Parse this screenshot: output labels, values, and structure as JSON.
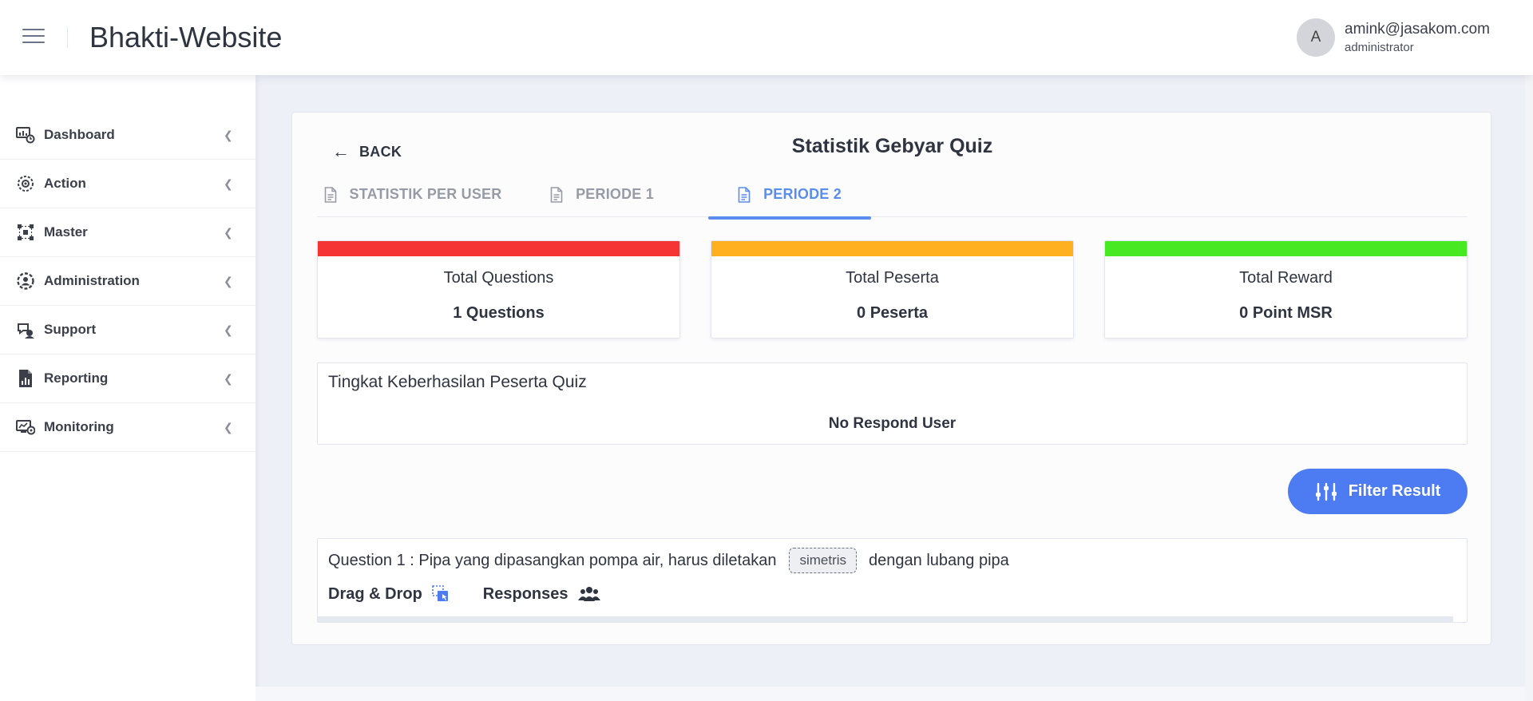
{
  "header": {
    "app_title": "Bhakti-Website",
    "user": {
      "avatar_letter": "A",
      "email": "amink@jasakom.com",
      "role": "administrator"
    }
  },
  "sidebar": {
    "items": [
      {
        "label": "Dashboard",
        "icon": "dashboard-icon"
      },
      {
        "label": "Action",
        "icon": "action-icon"
      },
      {
        "label": "Master",
        "icon": "master-icon"
      },
      {
        "label": "Administration",
        "icon": "administration-icon"
      },
      {
        "label": "Support",
        "icon": "support-icon"
      },
      {
        "label": "Reporting",
        "icon": "reporting-icon"
      },
      {
        "label": "Monitoring",
        "icon": "monitoring-icon"
      }
    ]
  },
  "page": {
    "back_label": "BACK",
    "title": "Statistik Gebyar Quiz",
    "tabs": [
      {
        "label": "STATISTIK PER USER",
        "active": false
      },
      {
        "label": "PERIODE 1",
        "active": false
      },
      {
        "label": "PERIODE 2",
        "active": true
      }
    ]
  },
  "stats": [
    {
      "title": "Total Questions",
      "value": "1 Questions",
      "color": "#f53434"
    },
    {
      "title": "Total Peserta",
      "value": "0 Peserta",
      "color": "#ffb020"
    },
    {
      "title": "Total Reward",
      "value": "0 Point MSR",
      "color": "#48e823"
    }
  ],
  "success_rate": {
    "title": "Tingkat Keberhasilan Peserta Quiz",
    "empty_text": "No Respond User"
  },
  "filter_button": {
    "label": "Filter Result"
  },
  "question": {
    "prefix": "Question 1 : Pipa yang dipasangkan pompa air, harus diletakan",
    "answer": "simetris",
    "suffix": "dengan lubang pipa",
    "type_label": "Drag & Drop",
    "responses_label": "Responses"
  },
  "colors": {
    "accent": "#5b8dee",
    "button": "#4d7cf2"
  }
}
